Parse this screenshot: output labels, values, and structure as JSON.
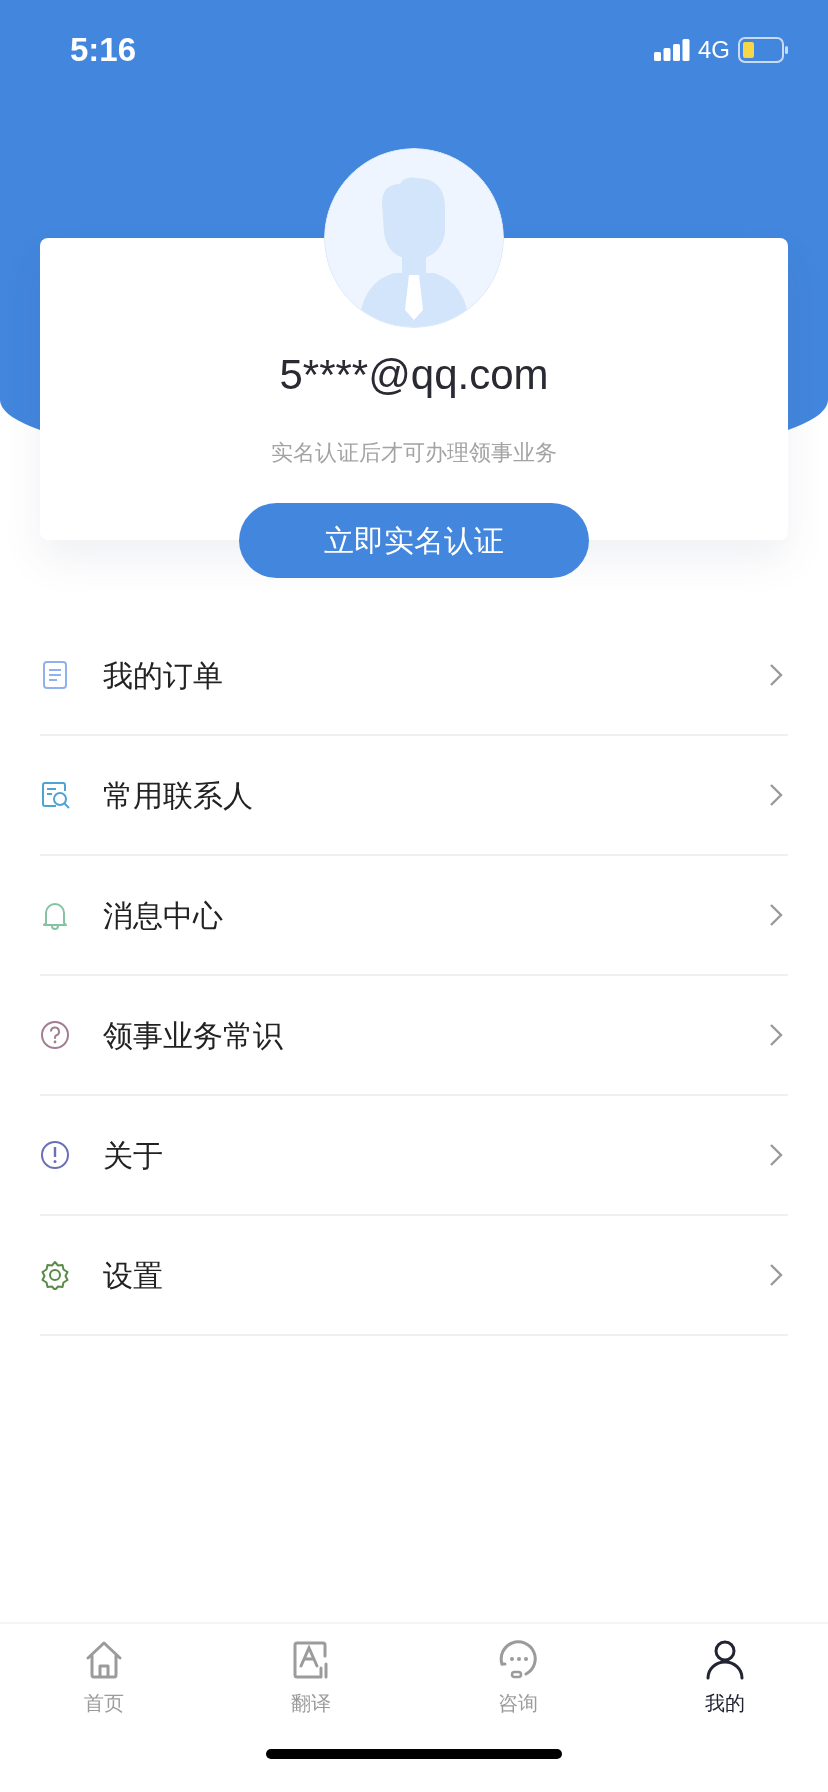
{
  "status_bar": {
    "time": "5:16",
    "network": "4G"
  },
  "profile": {
    "email": "5****@qq.com",
    "hint": "实名认证后才可办理领事业务",
    "verify_button": "立即实名认证"
  },
  "menu": [
    {
      "label": "我的订单"
    },
    {
      "label": "常用联系人"
    },
    {
      "label": "消息中心"
    },
    {
      "label": "领事业务常识"
    },
    {
      "label": "关于"
    },
    {
      "label": "设置"
    }
  ],
  "tabs": [
    {
      "label": "首页",
      "selected": false
    },
    {
      "label": "翻译",
      "selected": false
    },
    {
      "label": "咨询",
      "selected": false
    },
    {
      "label": "我的",
      "selected": true
    }
  ]
}
